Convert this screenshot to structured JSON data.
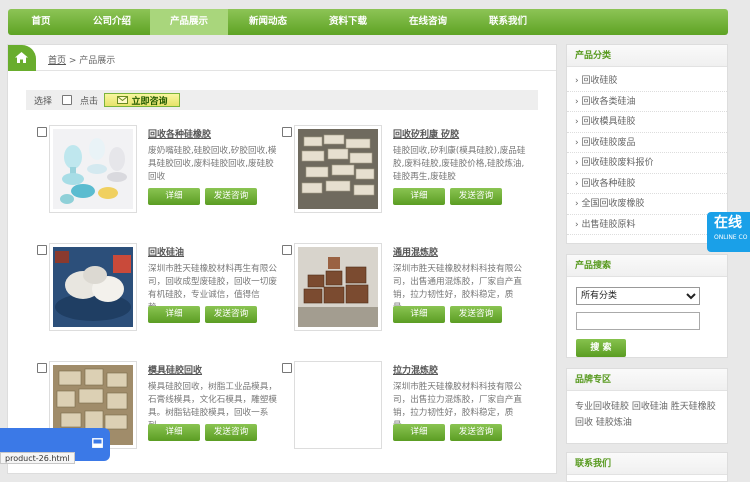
{
  "nav": [
    "首页",
    "公司介绍",
    "产品展示",
    "新闻动态",
    "资料下载",
    "在线咨询",
    "联系我们"
  ],
  "breadcrumb": {
    "home": "首页",
    "sep": " > ",
    "current": "产品展示"
  },
  "selbar": {
    "select": "选择",
    "click": "点击",
    "consult": "立即咨询"
  },
  "products": [
    {
      "title": "回收各种硅橡胶",
      "desc": "废奶嘴硅胶,硅胶回收,矽胶回收,模具硅胶回收,废料硅胶回收,废硅胶回收",
      "detail": "详细",
      "consult": "发送咨询"
    },
    {
      "title": "回收矽利康 矽胶",
      "desc": "硅胶回收,矽利康(模具硅胶),废品硅胶,废料硅胶,废硅胶价格,硅胶炼油,硅胶再生,废硅胶",
      "detail": "详细",
      "consult": "发送咨询"
    },
    {
      "title": "回收硅油",
      "desc": "深圳市胜天硅橡胶材料再生有限公司，回收成型废硅胶，回收一切废有机硅胶，专业诚信，值得信赖。...",
      "detail": "详细",
      "consult": "发送咨询"
    },
    {
      "title": "通用混炼胶",
      "desc": "深圳市胜天硅橡胶材料科技有限公司，出售通用混炼胶，厂家自产直销，拉力韧性好，胶料稳定，质量...",
      "detail": "详细",
      "consult": "发送咨询"
    },
    {
      "title": "模具硅胶回收",
      "desc": "模具硅胶回收，树脂工业品模具，石膏线模具，文化石模具，雕塑模具。树脂钻硅胶模具，回收一系列...",
      "detail": "详细",
      "consult": "发送咨询"
    },
    {
      "title": "拉力混炼胶",
      "desc": "深圳市胜天硅橡胶材料科技有限公司，出售拉力混炼胶，厂家自产直销，拉力韧性好，胶料稳定，质量...",
      "detail": "详细",
      "consult": "发送咨询"
    }
  ],
  "sidebar": {
    "cat_title": "产品分类",
    "categories": [
      "回收硅胶",
      "回收各类硅油",
      "回收模具硅胶",
      "回收硅胶废品",
      "回收硅胶废料报价",
      "回收各种硅胶",
      "全国回收废橡胶",
      "出售硅胶原料"
    ],
    "search_title": "产品搜索",
    "search_select": "所有分类",
    "search_btn": "搜 索",
    "brand_title": "品牌专区",
    "brand_keywords": "专业回收硅胶 回收硅油 胜天硅橡胶回收 硅胶炼油",
    "contact_title": "联系我们"
  },
  "floatbtn": {
    "big": "在线",
    "small": "ONLINE CO"
  },
  "status_url": "product-26.html"
}
